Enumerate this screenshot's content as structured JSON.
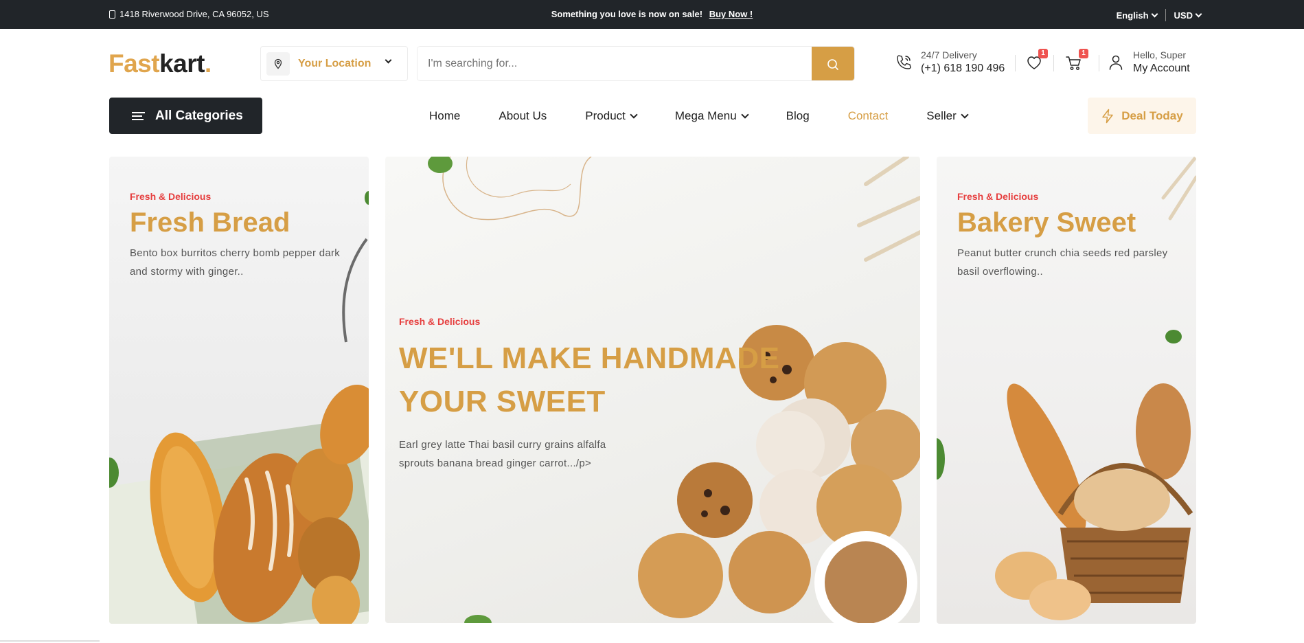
{
  "topbar": {
    "address": "1418 Riverwood Drive, CA 96052, US",
    "promo_text": "Something you love is now on sale!",
    "promo_link": "Buy Now !",
    "language": "English",
    "currency": "USD"
  },
  "header": {
    "logo_part1": "Fast",
    "logo_part2": "kart",
    "logo_dot": ".",
    "location_label": "Your Location",
    "search_placeholder": "I'm searching for...",
    "delivery_label": "24/7 Delivery",
    "delivery_phone": "(+1) 618 190 496",
    "wishlist_count": "1",
    "cart_count": "1",
    "account_greeting": "Hello, Super",
    "account_label": "My Account"
  },
  "nav": {
    "all_categories": "All Categories",
    "items": [
      {
        "label": "Home"
      },
      {
        "label": "About Us"
      },
      {
        "label": "Product"
      },
      {
        "label": "Mega Menu"
      },
      {
        "label": "Blog"
      },
      {
        "label": "Contact"
      },
      {
        "label": "Seller"
      }
    ],
    "deal_label": "Deal Today"
  },
  "banners": {
    "left": {
      "kicker": "Fresh & Delicious",
      "title": "Fresh Bread",
      "desc": "Bento box burritos cherry bomb pepper dark and stormy with ginger.."
    },
    "middle": {
      "kicker": "Fresh & Delicious",
      "title": "We'll Make Handmade Your Sweet",
      "desc": "Earl grey latte Thai basil curry grains alfalfa sprouts banana bread ginger carrot.../p>"
    },
    "right": {
      "kicker": "Fresh & Delicious",
      "title": "Bakery Sweet",
      "desc": "Peanut butter crunch chia seeds red parsley basil overflowing.."
    }
  },
  "colors": {
    "accent": "#d69e45",
    "dark": "#212529",
    "kicker": "#e63e3e"
  }
}
